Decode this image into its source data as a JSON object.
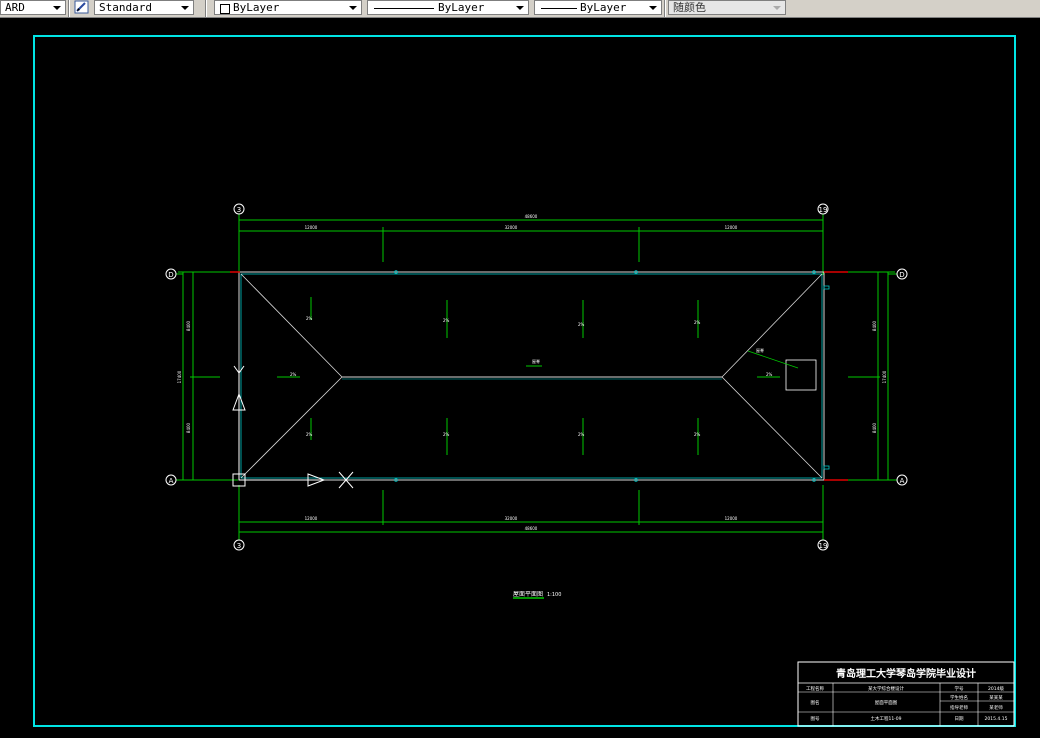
{
  "toolbar": {
    "text_style_partial": "ARD",
    "text_style": "Standard",
    "layer": "ByLayer",
    "linetype": "ByLayer",
    "lineweight": "ByLayer",
    "color": "随颜色"
  },
  "drawing": {
    "grid_top_left": "3",
    "grid_top_right": "19",
    "grid_bottom_left": "3",
    "grid_bottom_right": "19",
    "grid_left_top": "D",
    "grid_left_bottom": "A",
    "grid_right_top": "D",
    "grid_right_bottom": "A",
    "dim_total_top": "48600",
    "dim_seg1": "12000",
    "dim_seg2": "32000",
    "dim_seg3": "12000",
    "dim_total_bottom": "48600",
    "dim_bseg1": "12000",
    "dim_bseg2": "32000",
    "dim_bseg3": "12000",
    "dim_left_total": "17400",
    "dim_left_a": "8400",
    "dim_left_b": "8400",
    "dim_right_total": "17400",
    "dim_right_a": "8400",
    "dim_right_b": "8400",
    "ridge_label": "屋脊",
    "slope_label": "2%",
    "plan_title": "屋面平面图",
    "plan_scale": "1:100"
  },
  "title_block": {
    "school": "青岛理工大学琴岛学院毕业设计",
    "project_label": "工程名称",
    "project_value": "某大学综合楼设计",
    "drawing_label": "图名",
    "drawing_value": "屋面平面图",
    "student_label": "学号",
    "student_value": "2014级",
    "name_label": "学生姓名",
    "name_value": "某某某",
    "advisor_label": "指导老师",
    "advisor_value": "某老师",
    "sheet_label": "图号",
    "sheet_value": "土木工程11-09",
    "date_label": "日期",
    "date_value": "2015.4.15"
  }
}
